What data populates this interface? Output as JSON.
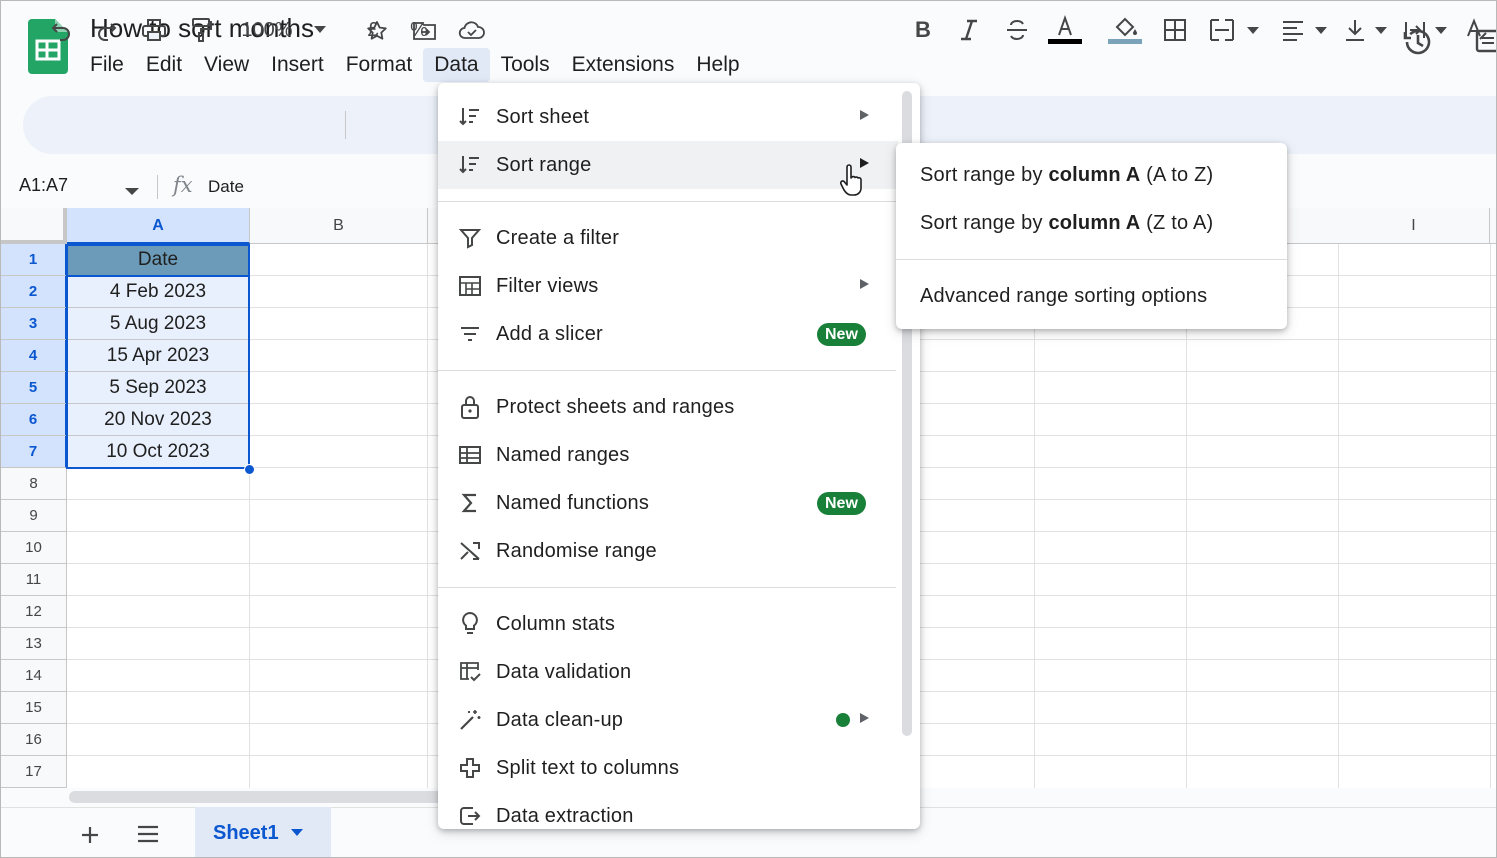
{
  "document": {
    "title": "How to sort months"
  },
  "menubar": [
    "File",
    "Edit",
    "View",
    "Insert",
    "Format",
    "Data",
    "Tools",
    "Extensions",
    "Help"
  ],
  "toolbar": {
    "zoom": "100%",
    "currency": "£",
    "percent": "%"
  },
  "formula_bar": {
    "name_box": "A1:A7",
    "fx": "fx",
    "content": "Date"
  },
  "grid": {
    "columns": [
      "A",
      "B",
      "I"
    ],
    "rows": [
      "1",
      "2",
      "3",
      "4",
      "5",
      "6",
      "7",
      "8",
      "9",
      "10",
      "11",
      "12",
      "13",
      "14",
      "15",
      "16",
      "17"
    ],
    "cells": [
      "Date",
      "4 Feb 2023",
      "5 Aug 2023",
      "15 Apr 2023",
      "5 Sep 2023",
      "20 Nov 2023",
      "10 Oct 2023"
    ]
  },
  "sheet_tab": "Sheet1",
  "data_menu": {
    "items": [
      {
        "label": "Sort sheet"
      },
      {
        "label": "Sort range"
      },
      {
        "label": "Create a filter"
      },
      {
        "label": "Filter views"
      },
      {
        "label": "Add a slicer",
        "badge": "New"
      },
      {
        "label": "Protect sheets and ranges"
      },
      {
        "label": "Named ranges"
      },
      {
        "label": "Named functions",
        "badge": "New"
      },
      {
        "label": "Randomise range"
      },
      {
        "label": "Column stats"
      },
      {
        "label": "Data validation"
      },
      {
        "label": "Data clean-up"
      },
      {
        "label": "Split text to columns"
      },
      {
        "label": "Data extraction"
      }
    ]
  },
  "sort_range_submenu": {
    "item1": {
      "prefix": "Sort range by ",
      "bold": "column A",
      "suffix": " (A to Z)"
    },
    "item2": {
      "prefix": "Sort range by ",
      "bold": "column A",
      "suffix": " (Z to A)"
    },
    "advanced": "Advanced range sorting options"
  }
}
